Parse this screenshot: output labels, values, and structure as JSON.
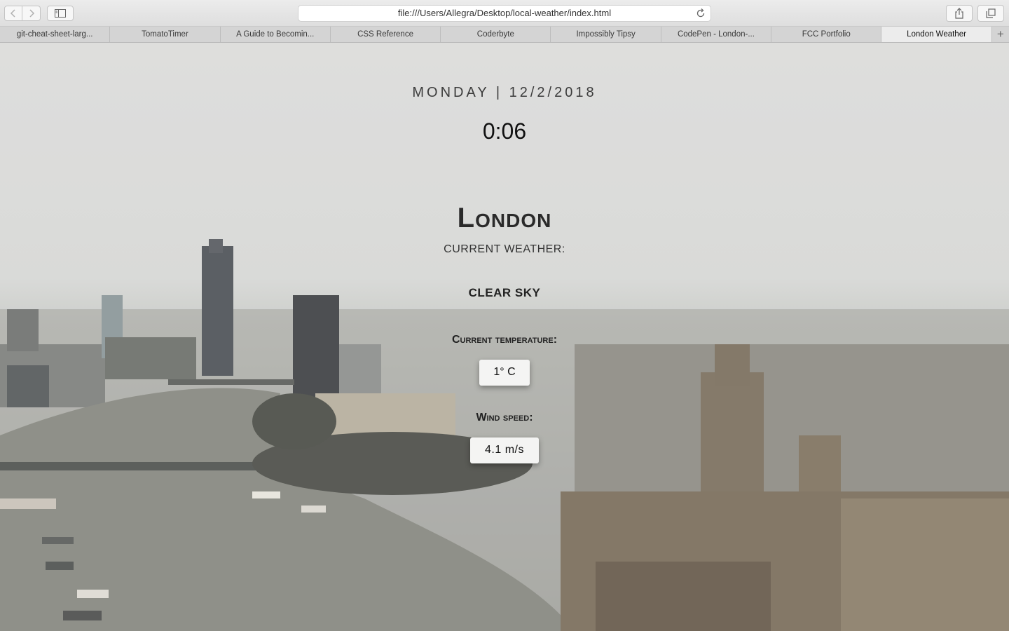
{
  "browser": {
    "url": "file:///Users/Allegra/Desktop/local-weather/index.html",
    "tabs": [
      {
        "label": "git-cheat-sheet-larg...",
        "active": false
      },
      {
        "label": "TomatoTimer",
        "active": false
      },
      {
        "label": "A Guide to Becomin...",
        "active": false
      },
      {
        "label": "CSS Reference",
        "active": false
      },
      {
        "label": "Coderbyte",
        "active": false
      },
      {
        "label": "Impossibly Tipsy",
        "active": false
      },
      {
        "label": "CodePen - London-...",
        "active": false
      },
      {
        "label": "FCC Portfolio",
        "active": false
      },
      {
        "label": "London Weather",
        "active": true
      }
    ],
    "new_tab_label": "+"
  },
  "weather": {
    "date": "MONDAY | 12/2/2018",
    "time": "0:06",
    "city": "London",
    "current_label": "CURRENT WEATHER:",
    "condition": "CLEAR SKY",
    "temp_label": "Current temperature:",
    "temperature": "1° C",
    "wind_label": "Wind speed:",
    "wind_speed": "4.1 m/s"
  },
  "icons": {
    "back": "chevron-left-icon",
    "forward": "chevron-right-icon",
    "sidebar": "sidebar-icon",
    "reload": "reload-icon",
    "share": "share-icon",
    "tabs": "tabs-overview-icon"
  }
}
